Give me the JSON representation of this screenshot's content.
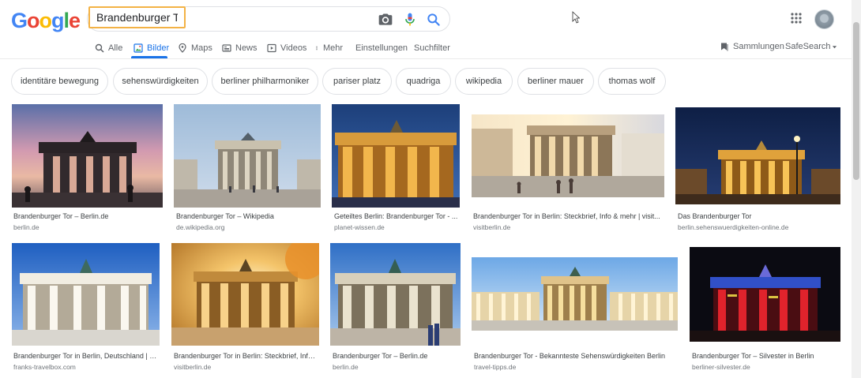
{
  "search": {
    "query": "Brandenburger Tor",
    "camera_icon": "camera-icon",
    "mic_icon": "mic-icon",
    "search_icon": "search-icon"
  },
  "logo": {
    "letters": [
      "G",
      "o",
      "o",
      "g",
      "l",
      "e"
    ],
    "colors": [
      "#4285f4",
      "#ea4335",
      "#fbbc05",
      "#4285f4",
      "#34a853",
      "#ea4335"
    ]
  },
  "nav": {
    "tabs": [
      {
        "label": "Alle",
        "icon": "search-icon"
      },
      {
        "label": "Bilder",
        "icon": "image-icon"
      },
      {
        "label": "Maps",
        "icon": "map-pin-icon"
      },
      {
        "label": "News",
        "icon": "newspaper-icon"
      },
      {
        "label": "Videos",
        "icon": "play-icon"
      },
      {
        "label": "Mehr",
        "icon": "more-vert-icon"
      }
    ],
    "settings": "Einstellungen",
    "filter": "Suchfilter",
    "collections": "Sammlungen",
    "safesearch": "SafeSearch"
  },
  "chips": [
    "identitäre bewegung",
    "sehenswürdigkeiten",
    "berliner philharmoniker",
    "pariser platz",
    "quadriga",
    "wikipedia",
    "berliner mauer",
    "thomas wolf"
  ],
  "results": [
    {
      "title": "Brandenburger Tor – Berlin.de",
      "source": "berlin.de"
    },
    {
      "title": "Brandenburger Tor – Wikipedia",
      "source": "de.wikipedia.org"
    },
    {
      "title": "Geteiltes Berlin: Brandenburger Tor - ...",
      "source": "planet-wissen.de"
    },
    {
      "title": "Brandenburger Tor in Berlin: Steckbrief, Info & mehr | visit...",
      "source": "visitberlin.de"
    },
    {
      "title": "Das Brandenburger Tor",
      "source": "berlin.sehenswuerdigkeiten-online.de"
    },
    {
      "title": "Brandenburger Tor in Berlin, Deutschland | F...",
      "source": "franks-travelbox.com"
    },
    {
      "title": "Brandenburger Tor in Berlin: Steckbrief, Info...",
      "source": "visitberlin.de"
    },
    {
      "title": "Brandenburger Tor – Berlin.de",
      "source": "berlin.de"
    },
    {
      "title": "Brandenburger Tor - Bekannteste Sehenswürdigkeiten Berlin",
      "source": "travel-tipps.de"
    },
    {
      "title": "Brandenburger Tor – Silvester in Berlin",
      "source": "berliner-silvester.de"
    }
  ],
  "colors": {
    "accent": "#1a73e8",
    "focus_outline": "#f3b245"
  }
}
